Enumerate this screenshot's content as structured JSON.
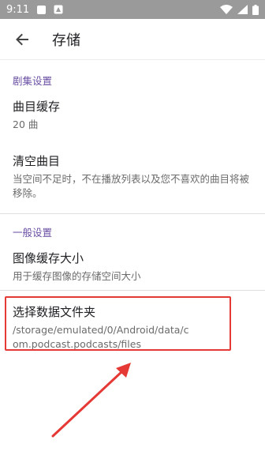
{
  "status_bar": {
    "time": "9:11",
    "icons": [
      "notification-square-icon",
      "sim-square-icon",
      "wifi-icon",
      "signal-icon",
      "battery-icon"
    ]
  },
  "app_bar": {
    "title": "存储"
  },
  "sections": [
    {
      "header": "剧集设置",
      "items": [
        {
          "title": "曲目缓存",
          "summary": "20 曲"
        },
        {
          "title": "清空曲目",
          "summary": "当空间不足时，不在播放列表以及您不喜欢的曲目将被移除。"
        }
      ]
    },
    {
      "header": "一般设置",
      "items": [
        {
          "title": "图像缓存大小",
          "summary": "用于缓存图像的存储空间大小"
        },
        {
          "title": "选择数据文件夹",
          "summary": "/storage/emulated/0/Android/data/com.podcast.podcasts/files"
        }
      ]
    }
  ],
  "colors": {
    "accent": "#6a4fa3",
    "annotation": "#e53935",
    "status_bar": "#9a9a9a"
  }
}
